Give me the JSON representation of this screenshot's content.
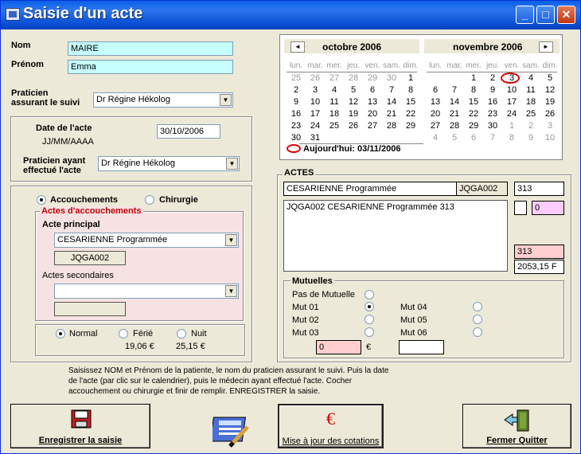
{
  "window": {
    "title": "Saisie d'un acte",
    "controls": [
      "_",
      "□",
      "✕"
    ]
  },
  "patient": {
    "nom_label": "Nom",
    "nom_value": "MAIRE",
    "prenom_label": "Prénom",
    "prenom_value": "Emma",
    "praticien_label_1": "Praticien",
    "praticien_label_2": "assurant le suivi",
    "praticien_value": "Dr Régine Hékolog"
  },
  "acte": {
    "date_label": "Date de l'acte",
    "date_format": "JJ/MM/AAAA",
    "date_value": "30/10/2006",
    "praticien_eff_label_1": "Praticien ayant",
    "praticien_eff_label_2": "effectué l'acte",
    "praticien_eff_value": "Dr Régine Hékolog"
  },
  "type": {
    "accouchements": "Accouchements",
    "chirurgie": "Chirurgie",
    "group_title": "Actes d'accouchements",
    "principal_label": "Acte principal",
    "principal_value": "CESARIENNE Programmée",
    "principal_code": "JQGA002",
    "secondaires_label": "Actes secondaires",
    "secondaires_value": "",
    "secondaires_code": ""
  },
  "tarif": {
    "normal": "Normal",
    "ferie": "Férié",
    "nuit": "Nuit",
    "ferie_price": "19,06 €",
    "nuit_price": "25,15 €"
  },
  "calendar": {
    "left_month": "octobre 2006",
    "right_month": "novembre 2006",
    "day_names": [
      "lun.",
      "mar.",
      "mer.",
      "jeu.",
      "ven.",
      "sam.",
      "dim."
    ],
    "today_label": "Aujourd'hui: 03/11/2006"
  },
  "actes_panel": {
    "title": "ACTES",
    "line_label": "CESARIENNE Programmée",
    "line_code": "JQGA002",
    "line_value": "313",
    "list_text": "JQGA002  CESARIENNE Programmée 313",
    "small_box": "",
    "lilac_value": "0",
    "total_pink": "313",
    "total_amount": "2053,15 F"
  },
  "mutuelles": {
    "title": "Mutuelles",
    "pas": "Pas de Mutuelle",
    "mut01": "Mut 01",
    "mut02": "Mut 02",
    "mut03": "Mut 03",
    "mut04": "Mut 04",
    "mut05": "Mut 05",
    "mut06": "Mut 06",
    "amount_value": "0",
    "currency": "€",
    "extra_value": ""
  },
  "instructions": "Saisissez NOM et Prénom de la patiente, le nom du praticien assurant le suivi. Puis la date de l'acte (par clic sur le calendrier),  puis le médecin ayant effectué l'acte. Cocher accouchement ou chirurgie et finir de remplir. ENREGISTRER la saisie.",
  "buttons": {
    "save": "Enregistrer la saisie",
    "update": "Mise à jour des cotations",
    "update_symbol": "€",
    "quit": "Fermer Quitter"
  }
}
